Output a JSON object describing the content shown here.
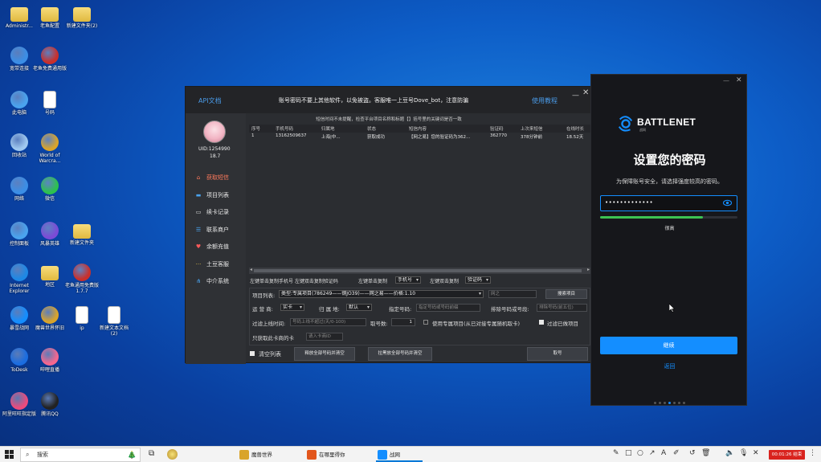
{
  "desktop": {
    "icons": [
      {
        "label": "Administr...",
        "icon": "user-folder-icon",
        "color": "#e6b94a"
      },
      {
        "label": "老鱼配置",
        "icon": "folder-icon",
        "color": "#f2cf62"
      },
      {
        "label": "新建文件夹(2)",
        "icon": "folder-icon",
        "color": "#f2cf62"
      },
      {
        "label": "宽带连接",
        "icon": "network-icon",
        "color": "#3b8ee6"
      },
      {
        "label": "老鱼免费通用版",
        "icon": "fish-app-icon",
        "color": "#c9302c"
      },
      {
        "label": "此电脑",
        "icon": "computer-icon",
        "color": "#4aa3ee"
      },
      {
        "label": "号码",
        "icon": "text-file-icon",
        "color": "#ffffff"
      },
      {
        "label": "回收站",
        "icon": "recycle-bin-icon",
        "color": "#9fc8ef"
      },
      {
        "label": "World of Warcra...",
        "icon": "warcraft-icon",
        "color": "#d9a42b"
      },
      {
        "label": "网络",
        "icon": "network-globe-icon",
        "color": "#3b8ee6"
      },
      {
        "label": "微信",
        "icon": "wechat-icon",
        "color": "#2dc14e"
      },
      {
        "label": "控制面板",
        "icon": "control-panel-icon",
        "color": "#4aa3ee"
      },
      {
        "label": "风暴英雄",
        "icon": "heroes-icon",
        "color": "#7b4bd6"
      },
      {
        "label": "新建文件夹",
        "icon": "folder-icon",
        "color": "#f2cf62"
      },
      {
        "label": "Internet Explorer",
        "icon": "ie-icon",
        "color": "#1e88e5"
      },
      {
        "label": "地区",
        "icon": "folder-icon",
        "color": "#f2cf62"
      },
      {
        "label": "老鱼通用免费版1.7.7",
        "icon": "fish-app-icon",
        "color": "#c9302c"
      },
      {
        "label": "暴雪战网",
        "icon": "battlenet-icon",
        "color": "#148eff"
      },
      {
        "label": "魔兽世界怀旧",
        "icon": "warcraft-icon",
        "color": "#d9a42b"
      },
      {
        "label": "ip",
        "icon": "text-file-icon",
        "color": "#ffffff"
      },
      {
        "label": "新建文本文档(2)",
        "icon": "text-file-icon",
        "color": "#ffffff"
      },
      {
        "label": "ToDesk",
        "icon": "todesk-icon",
        "color": "#1b6de0"
      },
      {
        "label": "哔哩直播",
        "icon": "bili-icon",
        "color": "#f4678f"
      },
      {
        "label": "阿里旺旺指定版",
        "icon": "wangwang-icon",
        "color": "#ea4b7d"
      },
      {
        "label": "腾讯QQ",
        "icon": "qq-icon",
        "color": "#222222"
      }
    ]
  },
  "tool_window": {
    "api_doc": "API文档",
    "notice": "账号密码不要上其他软件，以免被盗。客服唯一上豆号Dove_bot，注意防骗",
    "tutorial": "使用教程",
    "minimize": "—",
    "close": "✕",
    "sub_notice": "短信时间不未提醒，检查平台项目名称和标题【】括号里的关键词是否一致",
    "user": {
      "uid": "UID:1254990",
      "balance": "18.7"
    },
    "menu": [
      {
        "label": "获取短信",
        "icon": "home-icon",
        "active": true
      },
      {
        "label": "项目列表",
        "icon": "folder-icon",
        "active": false
      },
      {
        "label": "续卡记录",
        "icon": "monitor-icon",
        "active": false
      },
      {
        "label": "联系商户",
        "icon": "contact-icon",
        "active": false
      },
      {
        "label": "余额充值",
        "icon": "heart-icon",
        "active": false
      },
      {
        "label": "土豆客服",
        "icon": "dots-icon",
        "active": false
      },
      {
        "label": "中介系统",
        "icon": "network-icon",
        "active": false
      }
    ],
    "table": {
      "columns": [
        "序号",
        "手机号码",
        "归属地",
        "状态",
        "短信内容",
        "验证码",
        "上次来短信",
        "在线时长"
      ],
      "rows": [
        [
          "1",
          "13162509637",
          "上海|中...",
          "获取成功",
          "【网之易】您的验证码为362...",
          "362770",
          "378分钟前",
          "18.52天"
        ]
      ]
    },
    "copy_row": {
      "left_label": "左键单击复制手机号 左键双击复制验证码",
      "click_copy_label": "左键单击复制",
      "click_copy_value": "手机号",
      "dbl_copy_label": "左键双击复制",
      "dbl_copy_value": "验证码"
    },
    "form": {
      "project_label": "项目列表:",
      "project_value": "类型:专属项目(786249——钢JO39)——网之易——价格:1.10",
      "project_search_placeholder": "网之",
      "search_button": "搜索项目",
      "carrier_label": "运 营 商:",
      "carrier_value": "实卡",
      "region_label": "归 属 地:",
      "region_value": "默认",
      "specify_label": "指定号码:",
      "specify_placeholder": "指定号码或号码前缀",
      "exclude_label": "排除号码或号段:",
      "exclude_placeholder": "排除号码(前五位)",
      "filter_time_label": "过滤上线时间:",
      "filter_time_placeholder": "号码上线不超过(天/0-100)",
      "count_label": "取号数:",
      "count_value": "1",
      "use_exclusive_label": "使用专属项目(从已对接专属随机取卡)",
      "filter_used_label": "过滤已做项目",
      "only_card_label": "只获取此卡商的卡",
      "only_card_placeholder": "请入卡商ID",
      "clear_list_label": "清空列表",
      "release_all_button": "释放全部号码并清空",
      "blacklist_all_button": "拉黑放全部号码并清空",
      "get_number_button": "取号"
    }
  },
  "battlenet": {
    "minimize": "—",
    "close": "✕",
    "brand": "BATTLENET",
    "brand_sub": "战网",
    "title": "设置您的密码",
    "description": "为保障账号安全，请选择强度较高的密码。",
    "password_value": "•••••••••••••",
    "strength_fraction": 0.75,
    "strength_color": "#3cc452",
    "strength_label": "很高",
    "continue_button": "继续",
    "back_link": "返回",
    "pager_total": 7,
    "pager_active": 4,
    "accent": "#148eff"
  },
  "taskbar": {
    "search_placeholder": "搜索",
    "apps": [
      {
        "label": "魔兽世界",
        "icon": "warcraft-icon",
        "active": false
      },
      {
        "label": "在哪里得你",
        "icon": "flame-icon",
        "active": false
      },
      {
        "label": "战网",
        "icon": "battlenet-icon",
        "active": true
      }
    ],
    "recording": "00:01:26 结束"
  }
}
